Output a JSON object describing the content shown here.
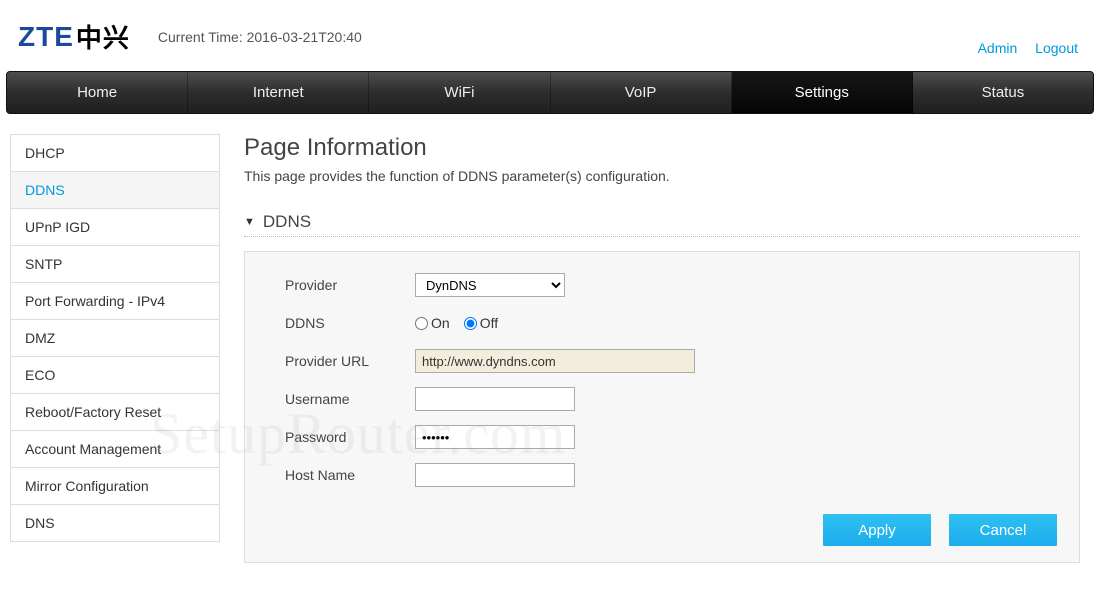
{
  "header": {
    "logo_roman": "ZTE",
    "logo_cn": "中兴",
    "current_time_label": "Current Time: 2016-03-21T20:40",
    "links": {
      "admin": "Admin",
      "logout": "Logout"
    }
  },
  "nav": {
    "items": [
      {
        "label": "Home",
        "active": false
      },
      {
        "label": "Internet",
        "active": false
      },
      {
        "label": "WiFi",
        "active": false
      },
      {
        "label": "VoIP",
        "active": false
      },
      {
        "label": "Settings",
        "active": true
      },
      {
        "label": "Status",
        "active": false
      }
    ]
  },
  "sidebar": {
    "items": [
      {
        "label": "DHCP",
        "active": false
      },
      {
        "label": "DDNS",
        "active": true
      },
      {
        "label": "UPnP IGD",
        "active": false
      },
      {
        "label": "SNTP",
        "active": false
      },
      {
        "label": "Port Forwarding - IPv4",
        "active": false
      },
      {
        "label": "DMZ",
        "active": false
      },
      {
        "label": "ECO",
        "active": false
      },
      {
        "label": "Reboot/Factory Reset",
        "active": false
      },
      {
        "label": "Account Management",
        "active": false
      },
      {
        "label": "Mirror Configuration",
        "active": false
      },
      {
        "label": "DNS",
        "active": false
      }
    ]
  },
  "page": {
    "title": "Page Information",
    "description": "This page provides the function of DDNS parameter(s) configuration.",
    "section_title": "DDNS"
  },
  "form": {
    "labels": {
      "provider": "Provider",
      "ddns": "DDNS",
      "on": "On",
      "off": "Off",
      "provider_url": "Provider URL",
      "username": "Username",
      "password": "Password",
      "hostname": "Host Name"
    },
    "values": {
      "provider_selected": "DynDNS",
      "ddns_state": "off",
      "provider_url": "http://www.dyndns.com",
      "username": "",
      "password": "••••••",
      "hostname": ""
    }
  },
  "buttons": {
    "apply": "Apply",
    "cancel": "Cancel"
  },
  "watermark": "SetupRouter.com"
}
